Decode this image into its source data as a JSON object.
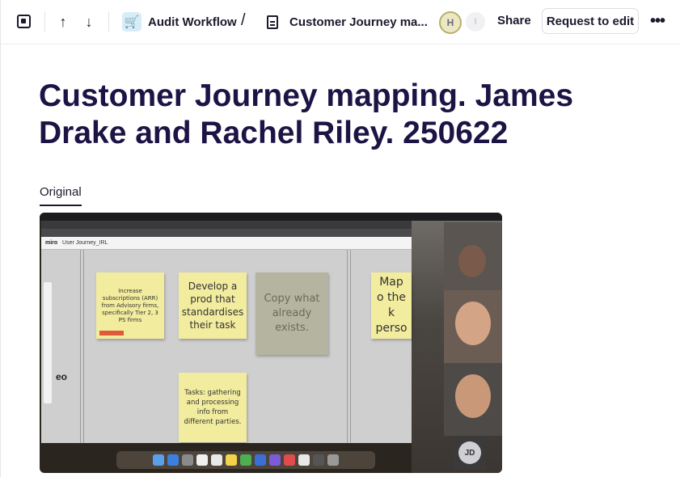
{
  "topbar": {
    "breadcrumb_workspace": "Audit Workflow",
    "breadcrumb_separator": "/",
    "breadcrumb_page": "Customer Journey ma...",
    "avatar_1_initial": "H",
    "avatar_2_initial": "I",
    "share_label": "Share",
    "request_edit_label": "Request to edit"
  },
  "icons": {
    "sidebar_toggle": "sidebar-toggle-icon",
    "up": "arrow-up-icon",
    "down": "arrow-down-icon",
    "workspace": "shopping-cart-icon",
    "page": "document-icon",
    "more": "more-horizontal-icon"
  },
  "page": {
    "title": "Customer Journey mapping. James Drake and Rachel Riley. 250622",
    "tab_label": "Original"
  },
  "screenshot": {
    "app_name": "miro",
    "board_name": "User Journey_IRL",
    "stickies": [
      "Increase subscriptions (ARR) from Advisory firms, specifically Tier 2, 3 PS firms",
      "Develop a prod that standardises their task",
      "Copy what already exists.",
      "Map o the k perso",
      "Tasks: gathering and processing info from different parties."
    ],
    "partial_text": "eo",
    "participant_initials": "JD"
  },
  "colors": {
    "title": "#1d1445",
    "text": "#1a1a2e",
    "sticky": "#f2ec9e"
  }
}
